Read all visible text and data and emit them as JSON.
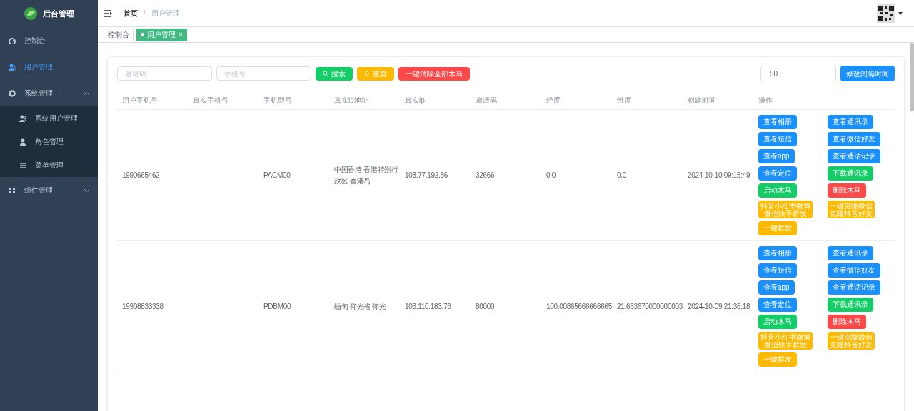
{
  "logo": {
    "title": "后台管理"
  },
  "sidebar": {
    "items": [
      {
        "label": "控制台",
        "selected": false
      },
      {
        "label": "用户管理",
        "selected": true
      },
      {
        "label": "系统管理",
        "selected": false,
        "expanded": true,
        "children": [
          {
            "label": "系统用户管理",
            "selected": false
          },
          {
            "label": "角色管理",
            "selected": false
          },
          {
            "label": "菜单管理",
            "selected": false
          }
        ]
      },
      {
        "label": "组件管理",
        "selected": false,
        "expanded": false
      }
    ]
  },
  "breadcrumb": {
    "items": [
      "首页",
      "用户管理"
    ],
    "separator": "/"
  },
  "tags": [
    {
      "label": "控制台",
      "selected": false
    },
    {
      "label": "用户管理",
      "selected": true,
      "close": "×"
    }
  ],
  "toolbar": {
    "fields": [
      {
        "placeholder": "邀请码"
      },
      {
        "placeholder": "手机号"
      }
    ],
    "buttons": [
      {
        "label": "搜索",
        "kind": "success"
      },
      {
        "label": "重置",
        "kind": "warning"
      },
      {
        "label": "一键清除全部木马",
        "kind": "danger"
      }
    ],
    "interval": {
      "value": "50"
    },
    "interval_button": "修改间隔时间"
  },
  "table": {
    "columns": [
      "用户手机号",
      "真实手机号",
      "手机型号",
      "真实ip地址",
      "真实ip",
      "邀请码",
      "经度",
      "维度",
      "创建时间",
      "操作"
    ],
    "rows": [
      {
        "cells": [
          "1990665462",
          "",
          "PACM00",
          "中国香港 香港特别行政区 香港岛",
          "103.77.192.86",
          "32666",
          "0.0",
          "0.0",
          "2024-10-10 09:15:49"
        ],
        "actions": [
          {
            "label": "查看相册",
            "kind": "primary"
          },
          {
            "label": "查看通讯录",
            "kind": "primary"
          },
          {
            "label": "查看短信",
            "kind": "primary"
          },
          {
            "label": "查看微信好友",
            "kind": "primary"
          },
          {
            "label": "查看app",
            "kind": "primary"
          },
          {
            "label": "查看通话记录",
            "kind": "primary"
          },
          {
            "label": "查看定位",
            "kind": "primary"
          },
          {
            "label": "下载通讯录",
            "kind": "success"
          },
          {
            "label": "启动木马",
            "kind": "success"
          },
          {
            "label": "删除木马",
            "kind": "danger"
          },
          {
            "label": "抖音小红书微博微信快手群发",
            "kind": "warning"
          },
          {
            "label": "一键克隆微信克隆抖音好友",
            "kind": "warning"
          },
          {
            "label": "一键群发",
            "kind": "warning"
          }
        ]
      },
      {
        "cells": [
          "19908833338",
          "",
          "PDBM00",
          "缅甸 仰光省 仰光",
          "103.110.183.76",
          "80000",
          "100.00865666666665",
          "21.663670000000003",
          "2024-10-09 21:36:18"
        ],
        "actions": [
          {
            "label": "查看相册",
            "kind": "primary"
          },
          {
            "label": "查看通讯录",
            "kind": "primary"
          },
          {
            "label": "查看短信",
            "kind": "primary"
          },
          {
            "label": "查看微信好友",
            "kind": "primary"
          },
          {
            "label": "查看app",
            "kind": "primary"
          },
          {
            "label": "查看通话记录",
            "kind": "primary"
          },
          {
            "label": "查看定位",
            "kind": "primary"
          },
          {
            "label": "下载通讯录",
            "kind": "success"
          },
          {
            "label": "启动木马",
            "kind": "success"
          },
          {
            "label": "删除木马",
            "kind": "danger"
          },
          {
            "label": "抖音小红书微博微信快手群发",
            "kind": "warning"
          },
          {
            "label": "一键克隆微信克隆抖音好友",
            "kind": "warning"
          },
          {
            "label": "一键群发",
            "kind": "warning"
          }
        ]
      }
    ]
  }
}
